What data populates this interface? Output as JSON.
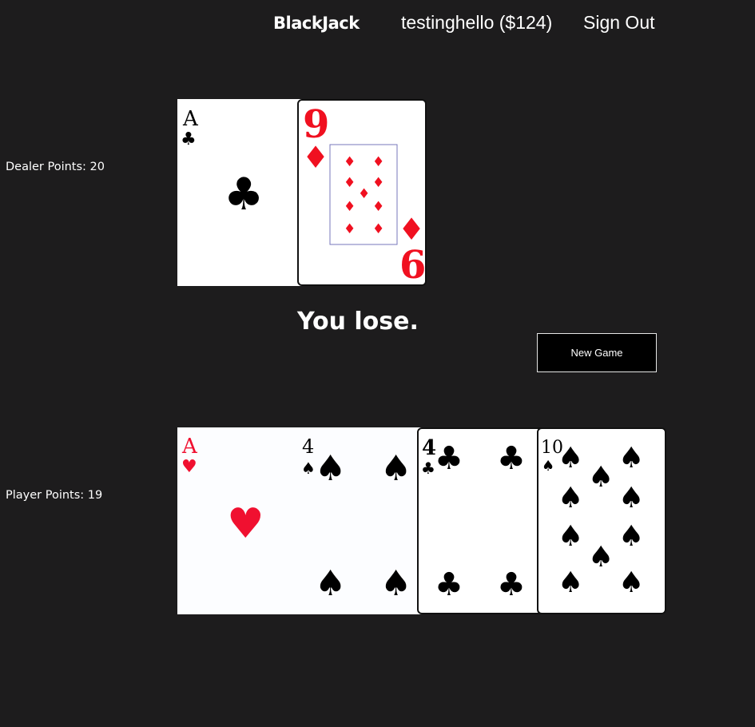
{
  "header": {
    "brand": "BlackJack",
    "user": "testinghello ($124)",
    "sign_out": "Sign Out"
  },
  "dealer": {
    "points_label": "Dealer Points: 20",
    "cards": [
      {
        "rank": "A",
        "suit": "clubs"
      },
      {
        "rank": "9",
        "suit": "diamonds"
      }
    ]
  },
  "result": "You lose.",
  "new_game_label": "New Game",
  "player": {
    "points_label": "Player Points: 19",
    "cards": [
      {
        "rank": "A",
        "suit": "hearts"
      },
      {
        "rank": "4",
        "suit": "spades"
      },
      {
        "rank": "4",
        "suit": "clubs"
      },
      {
        "rank": "10",
        "suit": "spades"
      }
    ]
  },
  "colors": {
    "background": "#1d1c1d",
    "red_suit": "#f01020",
    "black_suit": "#000000"
  }
}
